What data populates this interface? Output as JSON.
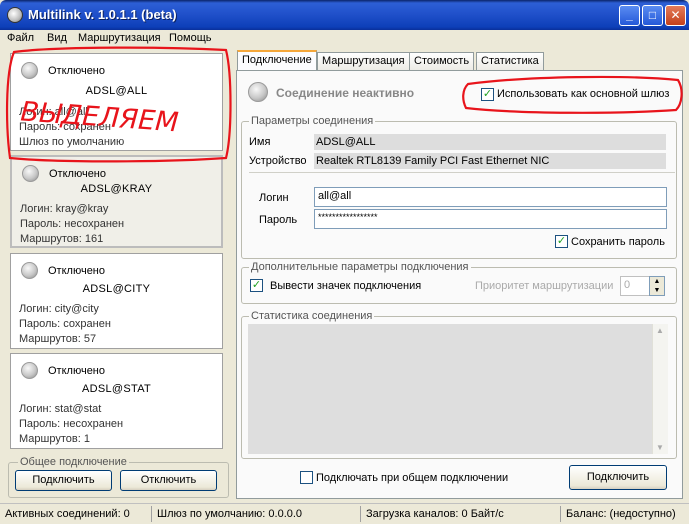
{
  "window": {
    "title": "Multilink v. 1.0.1.1 (beta)"
  },
  "menu": [
    "Файл",
    "Вид",
    "Маршрутизация",
    "Помощь"
  ],
  "connections": [
    {
      "status": "Отключено",
      "name": "ADSL@ALL",
      "login": "Логин:  all@all",
      "password": "Пароль: сохранен",
      "extra": "Шлюз по умолчанию"
    },
    {
      "status": "Отключено",
      "name": "ADSL@KRAY",
      "login": "Логин: kray@kray",
      "password": "Пароль: несохранен",
      "extra": "Маршрутов: 161"
    },
    {
      "status": "Отключено",
      "name": "ADSL@CITY",
      "login": "Логин:     city@city",
      "password": "Пароль: сохранен",
      "extra": "Маршрутов: 57"
    },
    {
      "status": "Отключено",
      "name": "ADSL@STAT",
      "login": "Логин:     stat@stat",
      "password": "Пароль: несохранен",
      "extra": "Маршрутов: 1"
    }
  ],
  "annotation": {
    "text": "ВЫДЕЛЯЕМ",
    "color": "#e8141b"
  },
  "general": {
    "title": "Общее подключение",
    "connect": "Подключить",
    "disconnect": "Отключить"
  },
  "tabs": [
    "Подключение",
    "Маршрутизация",
    "Стоимость",
    "Статистика"
  ],
  "panel": {
    "state": "Соединение неактивно",
    "use_default_gw": "Использовать как основной шлюз",
    "params_title": "Параметры соединения",
    "name_label": "Имя",
    "name_value": "ADSL@ALL",
    "device_label": "Устройство",
    "device_value": "Realtek RTL8139 Family PCI Fast Ethernet NIC",
    "login_label": "Логин",
    "login_value": "all@all",
    "password_label": "Пароль",
    "password_value": "*****************",
    "save_password": "Сохранить пароль",
    "extra_title": "Дополнительные параметры подключения",
    "show_icon": "Вывести значек подключения",
    "priority_label": "Приоритет маршрутизации",
    "priority_value": "0",
    "stats_title": "Статистика соединения",
    "connect_on_general": "Подключать при общем подключении",
    "connect_button": "Подключить"
  },
  "status": {
    "active": "Активных соединений: 0",
    "gateway": "Шлюз по умолчанию: 0.0.0.0",
    "load": "Загрузка каналов: 0 Байт/с",
    "balance": "Баланс: (недоступно)"
  }
}
